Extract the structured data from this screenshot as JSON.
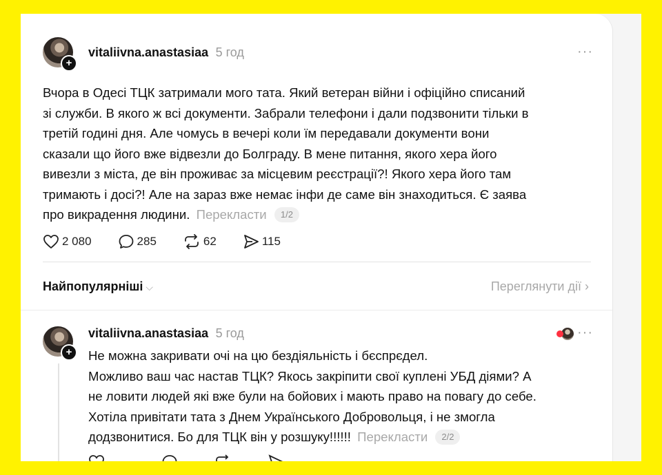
{
  "post": {
    "username": "vitaliivna.anastasiaa",
    "time": "5 год",
    "lines": [
      "Вчора в Одесі ТЦК затримали мого тата. Який ветеран війни і офіційно списаний",
      "зі служби. В якого ж всі документи. Забрали телефони і дали подзвонити тільки в",
      "третій годині дня. Але чомусь в вечері коли їм передавали документи вони",
      "сказали що його вже відвезли до Болграду. В мене питання, якого хера його",
      "вивезли з міста, де він проживає за місцевим реєстрації?! Якого хера його там",
      "тримають і досі?! Але на зараз вже немає інфи де саме він знаходиться. Є заява",
      "про викрадення людини."
    ],
    "translate_label": "Перекласти",
    "page": "1/2",
    "likes": "2 080",
    "replies": "285",
    "reposts": "62",
    "shares": "115",
    "more": "···"
  },
  "sort": {
    "label": "Найпопулярніші",
    "chevron": "⌵",
    "view_activity": "Переглянути дії ›"
  },
  "reply": {
    "username": "vitaliivna.anastasiaa",
    "time": "5 год",
    "lines": [
      "Не можна закривати очі на цю бездіяльність і бєспрєдел.",
      "Можливо ваш час настав ТЦК? Якось закріпити свої куплені УБД діями? А",
      "не ловити людей які вже були на бойових і мають право на повагу до себе.",
      "Хотіла привітати тата з Днем Українського Добровольця, і не змогла",
      "додзвонитися. Бо для ТЦК він у розшуку!!!!!!"
    ],
    "translate_label": "Перекласти",
    "page": "2/2",
    "more": "···"
  },
  "colors": {
    "background": "#FFF200",
    "card": "#ffffff",
    "muted": "#9a9a9a",
    "heart": "#ff3040"
  }
}
